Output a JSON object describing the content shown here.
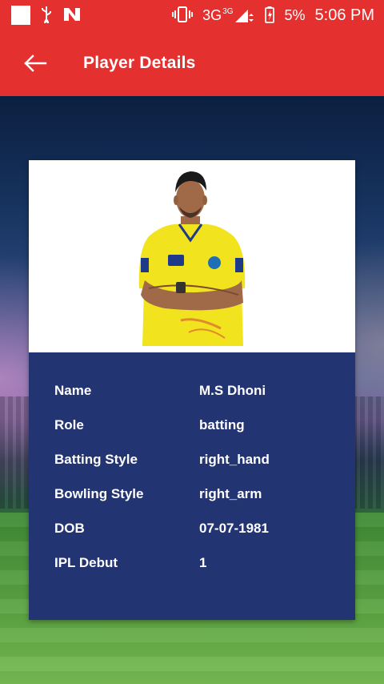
{
  "status_bar": {
    "network": "3G",
    "network_sup": "3G",
    "battery": "5%",
    "time": "5:06 PM"
  },
  "app_bar": {
    "title": "Player Details"
  },
  "player": {
    "fields": [
      {
        "label": "Name",
        "value": "M.S Dhoni"
      },
      {
        "label": "Role",
        "value": "batting"
      },
      {
        "label": "Batting Style",
        "value": "right_hand"
      },
      {
        "label": "Bowling Style",
        "value": "right_arm"
      },
      {
        "label": "DOB",
        "value": "07-07-1981"
      },
      {
        "label": "IPL Debut",
        "value": "1"
      }
    ]
  },
  "colors": {
    "app_bar": "#e53030",
    "details_panel": "#233472",
    "jersey": "#f2e31f"
  },
  "icons": {
    "back": "arrow-left-icon",
    "usb": "usb-icon",
    "vibrate": "vibrate-icon",
    "signal": "signal-icon",
    "battery": "battery-icon"
  }
}
